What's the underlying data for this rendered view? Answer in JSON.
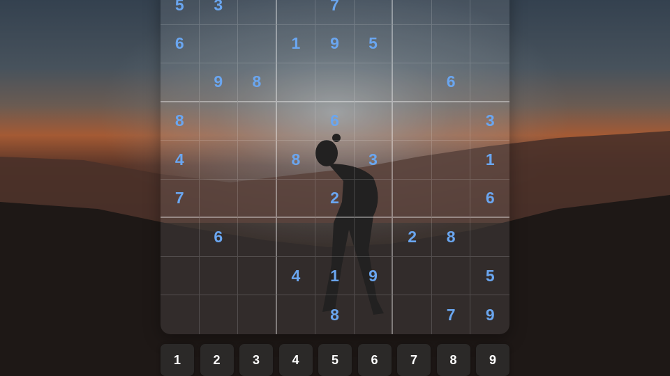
{
  "background": {
    "subject": "silhouette of a person standing on a mountain at sunset",
    "colors": {
      "sky_top": "#3b4a5a",
      "sky_glow": "#7a8a95",
      "horizon": "#c0683a",
      "ridge": "#3a2b26",
      "ground": "#141110"
    }
  },
  "board": {
    "rows": [
      [
        "5",
        "3",
        "",
        "",
        "7",
        "",
        "",
        "",
        ""
      ],
      [
        "6",
        "",
        "",
        "1",
        "9",
        "5",
        "",
        "",
        ""
      ],
      [
        "",
        "9",
        "8",
        "",
        "",
        "",
        "",
        "6",
        ""
      ],
      [
        "8",
        "",
        "",
        "",
        "6",
        "",
        "",
        "",
        "3"
      ],
      [
        "4",
        "",
        "",
        "8",
        "",
        "3",
        "",
        "",
        "1"
      ],
      [
        "7",
        "",
        "",
        "",
        "2",
        "",
        "",
        "",
        "6"
      ],
      [
        "",
        "6",
        "",
        "",
        "",
        "",
        "2",
        "8",
        ""
      ],
      [
        "",
        "",
        "",
        "4",
        "1",
        "9",
        "",
        "",
        "5"
      ],
      [
        "",
        "",
        "",
        "",
        "8",
        "",
        "",
        "7",
        "9"
      ]
    ],
    "given_digit_color": "#6aa6f0"
  },
  "numpad": {
    "keys": [
      "1",
      "2",
      "3",
      "4",
      "5",
      "6",
      "7",
      "8",
      "9"
    ]
  }
}
